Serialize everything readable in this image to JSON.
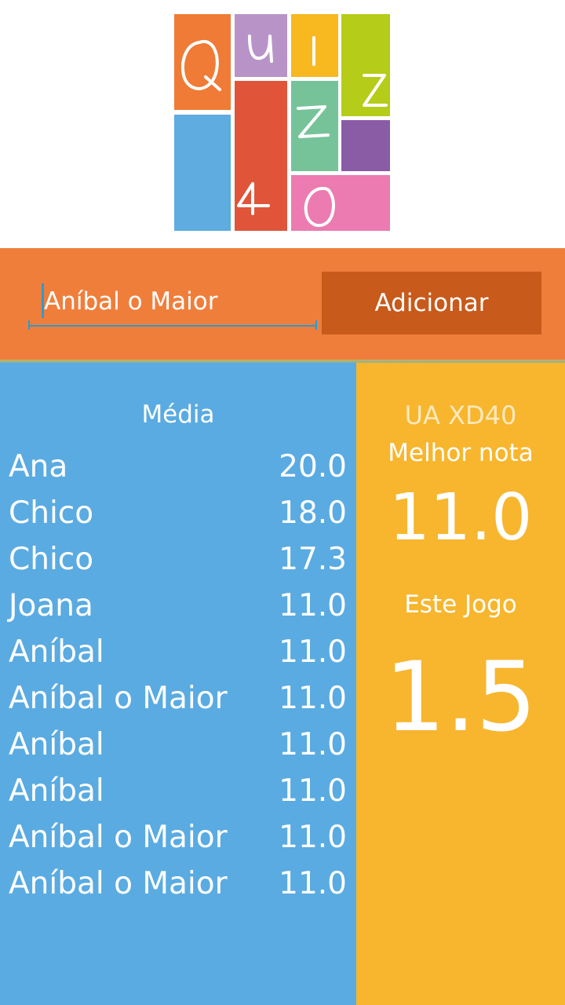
{
  "logo": {
    "letters": [
      "Q",
      "u",
      "i",
      "z",
      "z",
      "4",
      "0"
    ],
    "icon": "quizz40-logo",
    "colors": [
      "#ef7b36",
      "#b893c8",
      "#f7b820",
      "#b5cc18",
      "#5eace0",
      "#e0553a",
      "#76c39a",
      "#8a5ca6",
      "#eb7bb0"
    ]
  },
  "entry": {
    "value": "Aníbal o Maior",
    "button_label": "Adicionar"
  },
  "scores": {
    "header": "Média",
    "rows": [
      {
        "name": "Ana",
        "score": "20.0"
      },
      {
        "name": "Chico",
        "score": "18.0"
      },
      {
        "name": "Chico",
        "score": "17.3"
      },
      {
        "name": "Joana",
        "score": "11.0"
      },
      {
        "name": "Aníbal",
        "score": "11.0"
      },
      {
        "name": "Aníbal o Maior",
        "score": "11.0"
      },
      {
        "name": "Aníbal",
        "score": "11.0"
      },
      {
        "name": "Aníbal",
        "score": "11.0"
      },
      {
        "name": "Aníbal o Maior",
        "score": "11.0"
      },
      {
        "name": "Aníbal o Maior",
        "score": "11.0"
      }
    ]
  },
  "best": {
    "course": "UA XD40",
    "label": "Melhor nota",
    "value": "11.0"
  },
  "game": {
    "label": "Este Jogo",
    "value": "1.5"
  },
  "colors": {
    "orange": "#f07e3b",
    "button": "#c85a1b",
    "blue": "#5aabe1",
    "yellow": "#f7b62e",
    "accent": "#2a9bd4"
  }
}
